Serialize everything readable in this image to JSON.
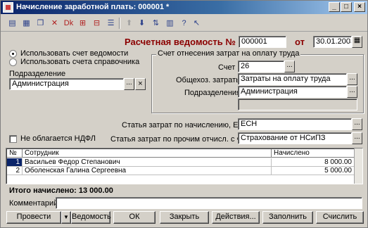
{
  "window": {
    "title": "Начисление заработной плать: 000001 *"
  },
  "toolbar": {
    "icons": [
      "save-icon",
      "print-icon",
      "copy-icon",
      "delete-icon",
      "debit-credit-icon",
      "structure-icon",
      "post-icon",
      "list-icon",
      "up-icon",
      "down-icon",
      "sort-icon",
      "table-icon",
      "help-icon",
      "cursor-help-icon"
    ]
  },
  "header": {
    "doc_title": "Расчетная ведомость №",
    "number": "000001",
    "date_label": "от",
    "date": "30.01.2003"
  },
  "radio": {
    "use_statement_account": "Использовать счет ведомости",
    "use_reference_account": "Использовать счета справочника"
  },
  "department": {
    "label": "Подразделение",
    "value": "Администрация"
  },
  "group": {
    "title": "Счет отнесения затрат на оплату труда",
    "account_label": "Счет",
    "account_value": "26",
    "costs_label": "Общехоз. затраты",
    "costs_value": "Затраты на оплату труда",
    "dept_label": "Подразделения",
    "dept_value": "Администрация"
  },
  "esn": {
    "label": "Статья затрат по начислению, ЕСН",
    "value": "ЕСН"
  },
  "fot": {
    "label": "Статья затрат по прочим отчисл. с ФОТ",
    "value": "Страхование от НСиПЗ"
  },
  "ndfl": {
    "label": "Не облагается НДФЛ"
  },
  "table": {
    "columns": [
      "№",
      "Сотрудник",
      "Начислено"
    ],
    "rows": [
      {
        "num": "1",
        "employee": "Васильев Федор Степанович",
        "amount": "8 000.00"
      },
      {
        "num": "2",
        "employee": "Оболенская Галина Сергеевна",
        "amount": "5 000.00"
      }
    ]
  },
  "total": {
    "text": "Итого начислено: 13 000.00"
  },
  "comment": {
    "label": "Комментарий:",
    "value": ""
  },
  "buttons": {
    "post": "Провести",
    "statement": "Ведомость",
    "ok": "ОК",
    "close": "Закрыть",
    "actions": "Действия...",
    "fill": "Заполнить",
    "calculate": "Счислить"
  },
  "colors": {
    "title_bar": "#0a246a",
    "face": "#d4d0c8",
    "accent_text": "#8b0000"
  }
}
